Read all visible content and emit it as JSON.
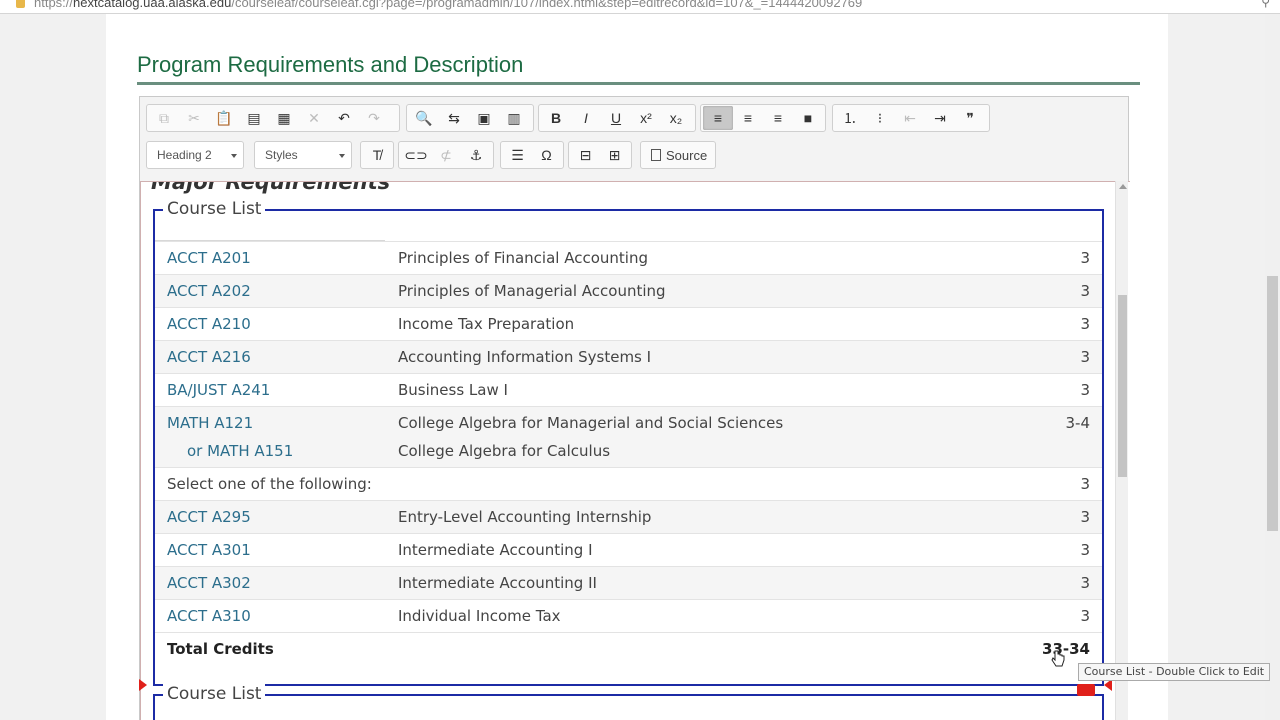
{
  "browser": {
    "url_prefix": "https://",
    "url_host": "nextcatalog.uaa.alaska.edu",
    "url_path": "/courseleaf/courseleaf.cgi?page=/programadmin/107/index.html&step=editrecord&id=107&_=1444420092769"
  },
  "section": {
    "title": "Program Requirements and Description"
  },
  "toolbar": {
    "format_combo": "Heading 2",
    "styles_combo": "Styles",
    "source_label": "Source",
    "buttons_row1": [
      {
        "name": "copy-icon",
        "glyph": "⧉",
        "disabled": true
      },
      {
        "name": "cut-icon",
        "glyph": "✂",
        "disabled": true
      },
      {
        "name": "paste-icon",
        "glyph": "📋",
        "disabled": false
      },
      {
        "name": "paste-text-icon",
        "glyph": "▤",
        "disabled": false
      },
      {
        "name": "paste-word-icon",
        "glyph": "▦",
        "disabled": false
      },
      {
        "name": "remove-icon",
        "glyph": "✕",
        "disabled": true
      },
      {
        "name": "undo-icon",
        "glyph": "↶",
        "disabled": false
      },
      {
        "name": "redo-icon",
        "glyph": "↷",
        "disabled": true
      },
      {
        "name": "find-icon",
        "glyph": "🔍",
        "disabled": false
      },
      {
        "name": "replace-icon",
        "glyph": "⇆",
        "disabled": false
      },
      {
        "name": "select-all-icon",
        "glyph": "▣",
        "disabled": false
      },
      {
        "name": "spellcheck-icon",
        "glyph": "▥",
        "disabled": false
      },
      {
        "name": "bold-icon",
        "glyph": "B",
        "disabled": false
      },
      {
        "name": "italic-icon",
        "glyph": "I",
        "disabled": false
      },
      {
        "name": "underline-icon",
        "glyph": "U",
        "disabled": false
      },
      {
        "name": "superscript-icon",
        "glyph": "x²",
        "disabled": false
      },
      {
        "name": "subscript-icon",
        "glyph": "x₂",
        "disabled": false
      },
      {
        "name": "align-left-icon",
        "glyph": "≡",
        "disabled": false
      },
      {
        "name": "align-center-icon",
        "glyph": "≡",
        "disabled": false
      },
      {
        "name": "align-right-icon",
        "glyph": "≡",
        "disabled": false
      },
      {
        "name": "justify-icon",
        "glyph": "■",
        "disabled": false
      },
      {
        "name": "numbered-list-icon",
        "glyph": "⒈",
        "disabled": false
      },
      {
        "name": "bulleted-list-icon",
        "glyph": "⁝",
        "disabled": false
      },
      {
        "name": "outdent-icon",
        "glyph": "⇤",
        "disabled": true
      },
      {
        "name": "indent-icon",
        "glyph": "⇥",
        "disabled": false
      },
      {
        "name": "blockquote-icon",
        "glyph": "❞",
        "disabled": false
      }
    ],
    "buttons_row2": [
      {
        "name": "remove-format-icon",
        "glyph": "T̸",
        "disabled": false
      },
      {
        "name": "link-icon",
        "glyph": "⊂⊃",
        "disabled": false
      },
      {
        "name": "unlink-icon",
        "glyph": "⊄",
        "disabled": true
      },
      {
        "name": "anchor-icon",
        "glyph": "⚓",
        "disabled": false
      },
      {
        "name": "horizontal-rule-icon",
        "glyph": "☰",
        "disabled": false
      },
      {
        "name": "special-char-icon",
        "glyph": "Ω",
        "disabled": false
      },
      {
        "name": "insert-course-list-icon",
        "glyph": "⊟",
        "disabled": false
      },
      {
        "name": "table-icon",
        "glyph": "⊞",
        "disabled": false
      }
    ]
  },
  "content": {
    "heading_partial": "Major Requirements",
    "course_list_legend": "Course List",
    "rows": [
      {
        "code": "ACCT A201",
        "title": "Principles of Financial Accounting",
        "hours": "3"
      },
      {
        "code": "ACCT A202",
        "title": "Principles of Managerial Accounting",
        "hours": "3"
      },
      {
        "code": "ACCT A210",
        "title": "Income Tax Preparation",
        "hours": "3"
      },
      {
        "code": "ACCT A216",
        "title": "Accounting Information Systems I",
        "hours": "3"
      },
      {
        "code": "BA/JUST A241",
        "title": "Business Law I",
        "hours": "3"
      },
      {
        "code": "MATH A121",
        "title": "College Algebra for Managerial and Social Sciences",
        "hours": "3-4",
        "or_code": "or MATH A151",
        "or_title": "College Algebra for Calculus"
      },
      {
        "plain": "Select one of the following:",
        "hours": "3"
      },
      {
        "code": "ACCT A295",
        "title": "Entry-Level Accounting Internship",
        "hours": "3"
      },
      {
        "code": "ACCT A301",
        "title": "Intermediate Accounting I",
        "hours": "3"
      },
      {
        "code": "ACCT A302",
        "title": "Intermediate Accounting II",
        "hours": "3"
      },
      {
        "code": "ACCT A310",
        "title": "Individual Income Tax",
        "hours": "3"
      }
    ],
    "total_label": "Total Credits",
    "total_hours": "33-34",
    "second_legend": "Course List",
    "tooltip": "Course List - Double Click to Edit"
  }
}
